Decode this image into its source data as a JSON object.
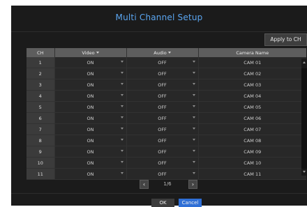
{
  "dialog": {
    "title": "Multi Channel Setup",
    "apply_button_label": "Apply to CH"
  },
  "table": {
    "headers": {
      "ch": "CH",
      "video": "Video",
      "audio": "Audio",
      "camera_name": "Camera Name"
    },
    "rows": [
      {
        "ch": "1",
        "video": "ON",
        "audio": "OFF",
        "name": "CAM 01"
      },
      {
        "ch": "2",
        "video": "ON",
        "audio": "OFF",
        "name": "CAM 02"
      },
      {
        "ch": "3",
        "video": "ON",
        "audio": "OFF",
        "name": "CAM 03"
      },
      {
        "ch": "4",
        "video": "ON",
        "audio": "OFF",
        "name": "CAM 04"
      },
      {
        "ch": "5",
        "video": "ON",
        "audio": "OFF",
        "name": "CAM 05"
      },
      {
        "ch": "6",
        "video": "ON",
        "audio": "OFF",
        "name": "CAM 06"
      },
      {
        "ch": "7",
        "video": "ON",
        "audio": "OFF",
        "name": "CAM 07"
      },
      {
        "ch": "8",
        "video": "ON",
        "audio": "OFF",
        "name": "CAM 08"
      },
      {
        "ch": "9",
        "video": "ON",
        "audio": "OFF",
        "name": "CAM 09"
      },
      {
        "ch": "10",
        "video": "ON",
        "audio": "OFF",
        "name": "CAM 10"
      },
      {
        "ch": "11",
        "video": "ON",
        "audio": "OFF",
        "name": "CAM 11"
      }
    ]
  },
  "pager": {
    "prev_icon": "‹",
    "next_icon": "›",
    "page_label": "1/6"
  },
  "footer": {
    "ok_label": "OK",
    "cancel_label": "Cancel"
  },
  "colors": {
    "title": "#5aa5f0",
    "background": "#1b1b1b",
    "cancel_button": "#2f6fd6"
  }
}
